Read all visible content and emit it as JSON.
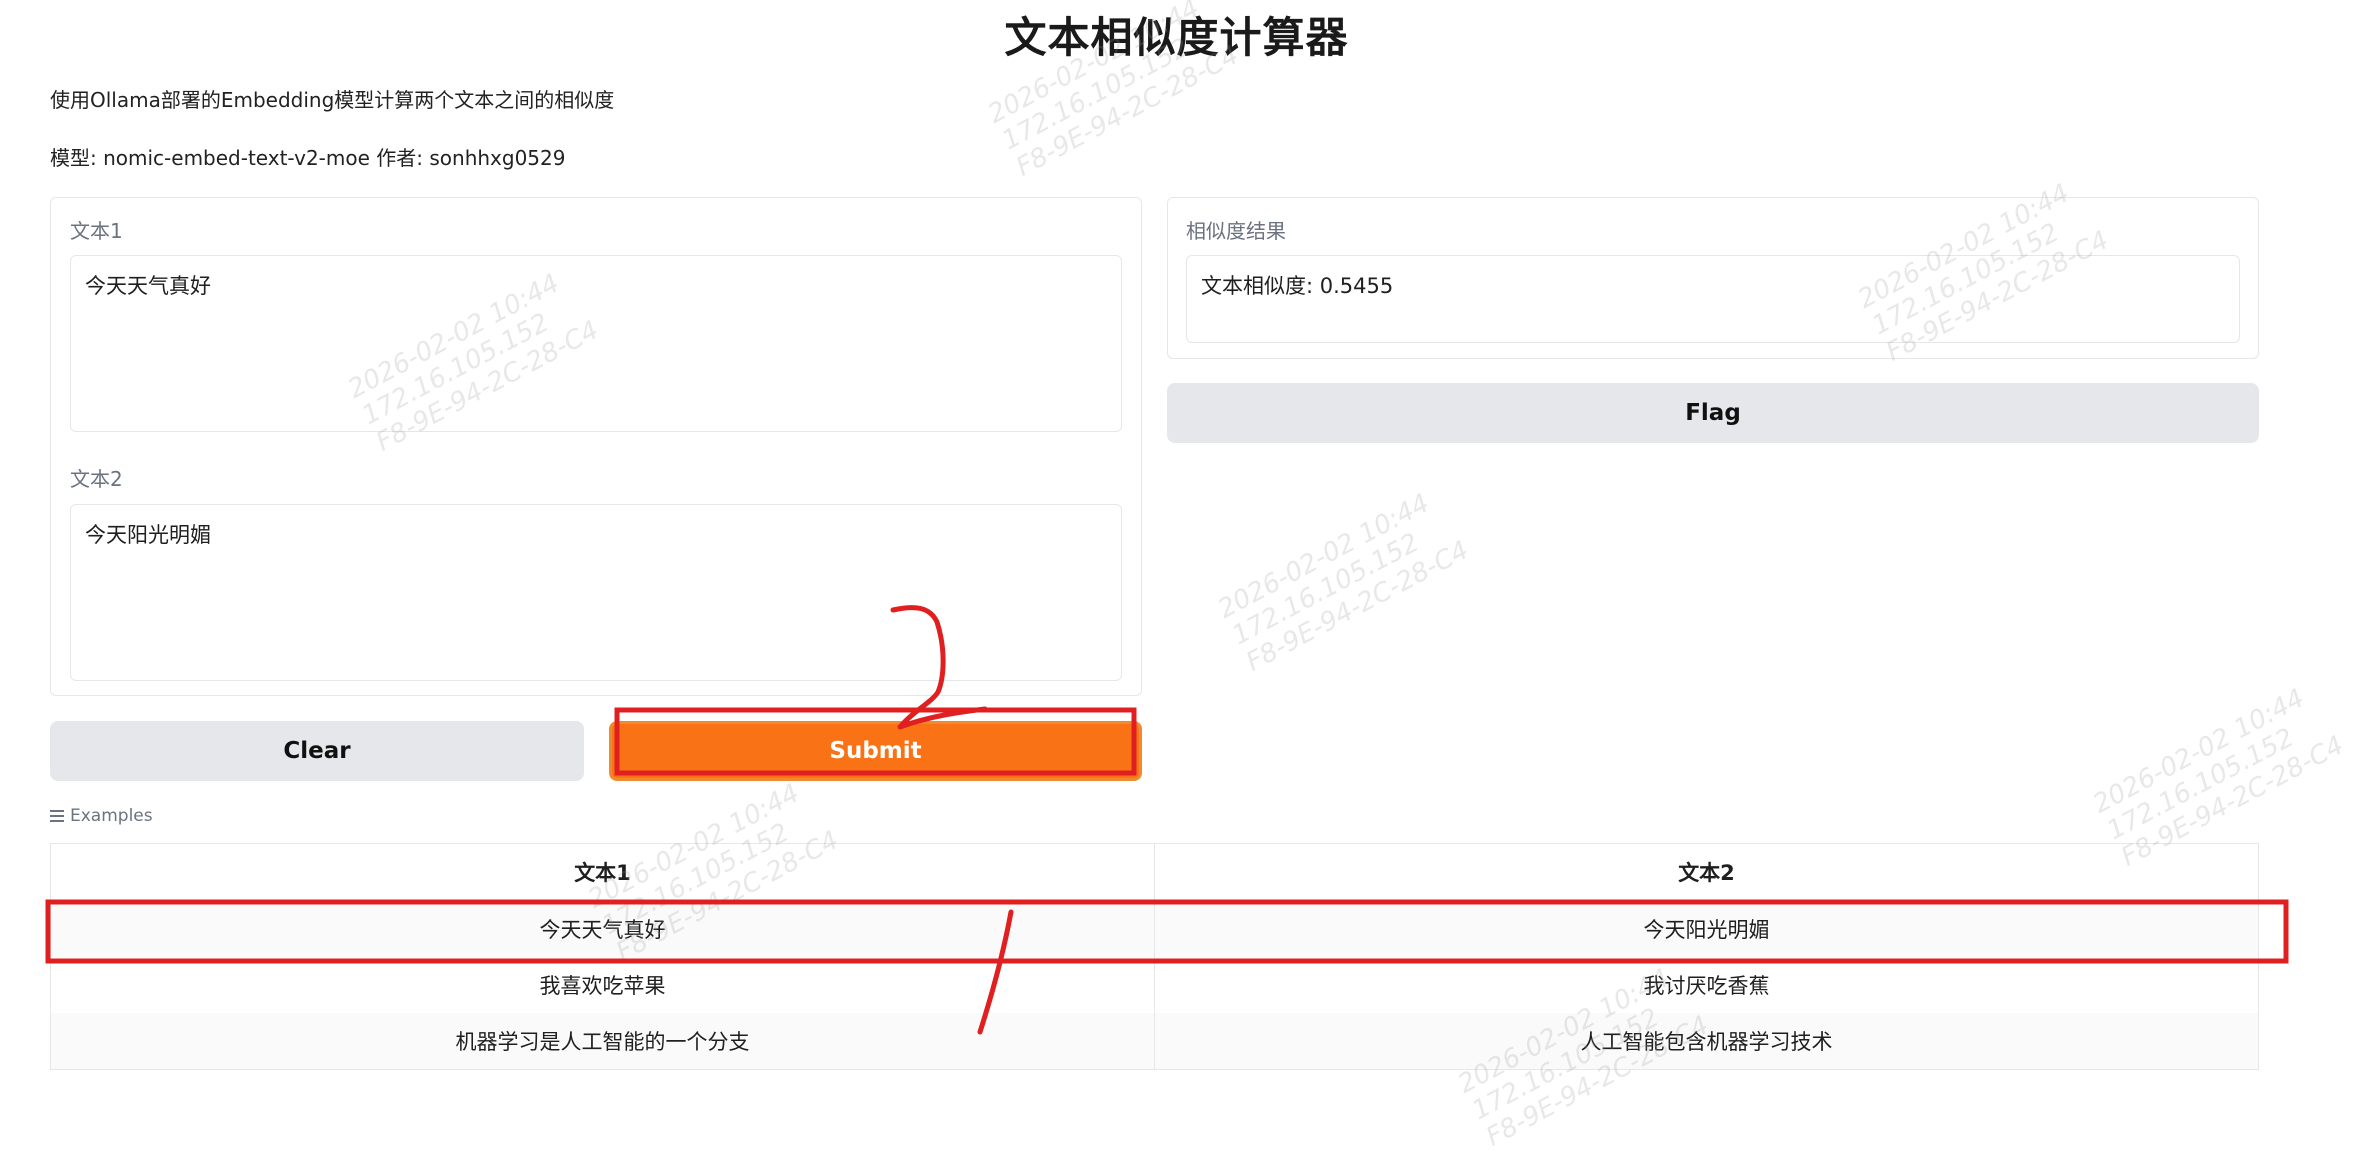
{
  "page": {
    "title": "文本相似度计算器",
    "description": "使用Ollama部署的Embedding模型计算两个文本之间的相似度",
    "model_info": "模型: nomic-embed-text-v2-moe 作者: sonhhxg0529"
  },
  "inputs": {
    "text1_label": "文本1",
    "text1_value": "今天天气真好",
    "text2_label": "文本2",
    "text2_value": "今天阳光明媚"
  },
  "output": {
    "label": "相似度结果",
    "value": "文本相似度: 0.5455"
  },
  "buttons": {
    "clear": "Clear",
    "submit": "Submit",
    "flag": "Flag"
  },
  "examples": {
    "label": "Examples",
    "headers": [
      "文本1",
      "文本2"
    ],
    "rows": [
      [
        "今天天气真好",
        "今天阳光明媚"
      ],
      [
        "我喜欢吃苹果",
        "我讨厌吃香蕉"
      ],
      [
        "机器学习是人工智能的一个分支",
        "人工智能包含机器学习技术"
      ]
    ]
  },
  "watermark": {
    "line1": "2026-02-02 10:44",
    "line2": "172.16.105.152",
    "line3": "F8-9E-94-2C-28-C4"
  },
  "colors": {
    "primary": "#f97316",
    "secondary": "#e5e7eb",
    "annotation": "#e02020"
  }
}
